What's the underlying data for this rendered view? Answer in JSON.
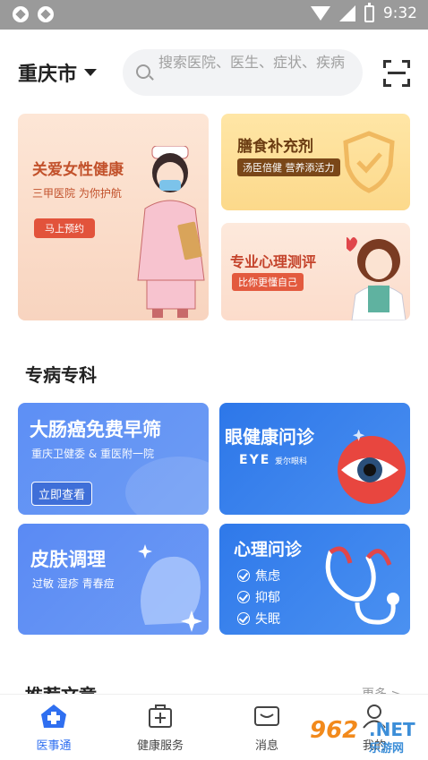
{
  "status_bar": {
    "time": "9:32"
  },
  "header": {
    "city": "重庆市",
    "search_placeholder": "搜索医院、医生、症状、疾病"
  },
  "banners": {
    "women_health": {
      "title": "关爱女性健康",
      "subtitle": "三甲医院 为你护航",
      "button": "马上预约"
    },
    "diet": {
      "title": "膳食补充剂",
      "tag": "汤臣倍健 营养添活力"
    },
    "psych_test": {
      "title": "专业心理测评",
      "tag": "比你更懂自己"
    }
  },
  "specialty": {
    "title": "专病专科",
    "cards": [
      {
        "title": "大肠癌免费早筛",
        "subtitle": "重庆卫健委 & 重医附一院",
        "button": "立即查看"
      },
      {
        "title": "眼健康问诊",
        "brand": "EYE",
        "brand_sub": "爱尔眼科"
      },
      {
        "title": "皮肤调理",
        "subtitle": "过敏  湿疹  青春痘"
      },
      {
        "title": "心理问诊",
        "items": [
          "焦虑",
          "抑郁",
          "失眠"
        ]
      }
    ]
  },
  "recommend": {
    "title": "推荐文章",
    "more": "更多 >"
  },
  "bottom_nav": {
    "tabs": [
      {
        "label": "医事通",
        "icon": "home-cross-icon",
        "active": true
      },
      {
        "label": "健康服务",
        "icon": "medical-box-icon",
        "active": false
      },
      {
        "label": "消息",
        "icon": "message-icon",
        "active": false
      },
      {
        "label": "我的",
        "icon": "profile-icon",
        "active": false
      }
    ]
  },
  "watermark": {
    "number": "962",
    "net": ".NET",
    "site": "乐游网"
  },
  "colors": {
    "accent": "#2f6ff0",
    "card_blue": "#4a8ff0",
    "banner_red": "#e2533b"
  }
}
